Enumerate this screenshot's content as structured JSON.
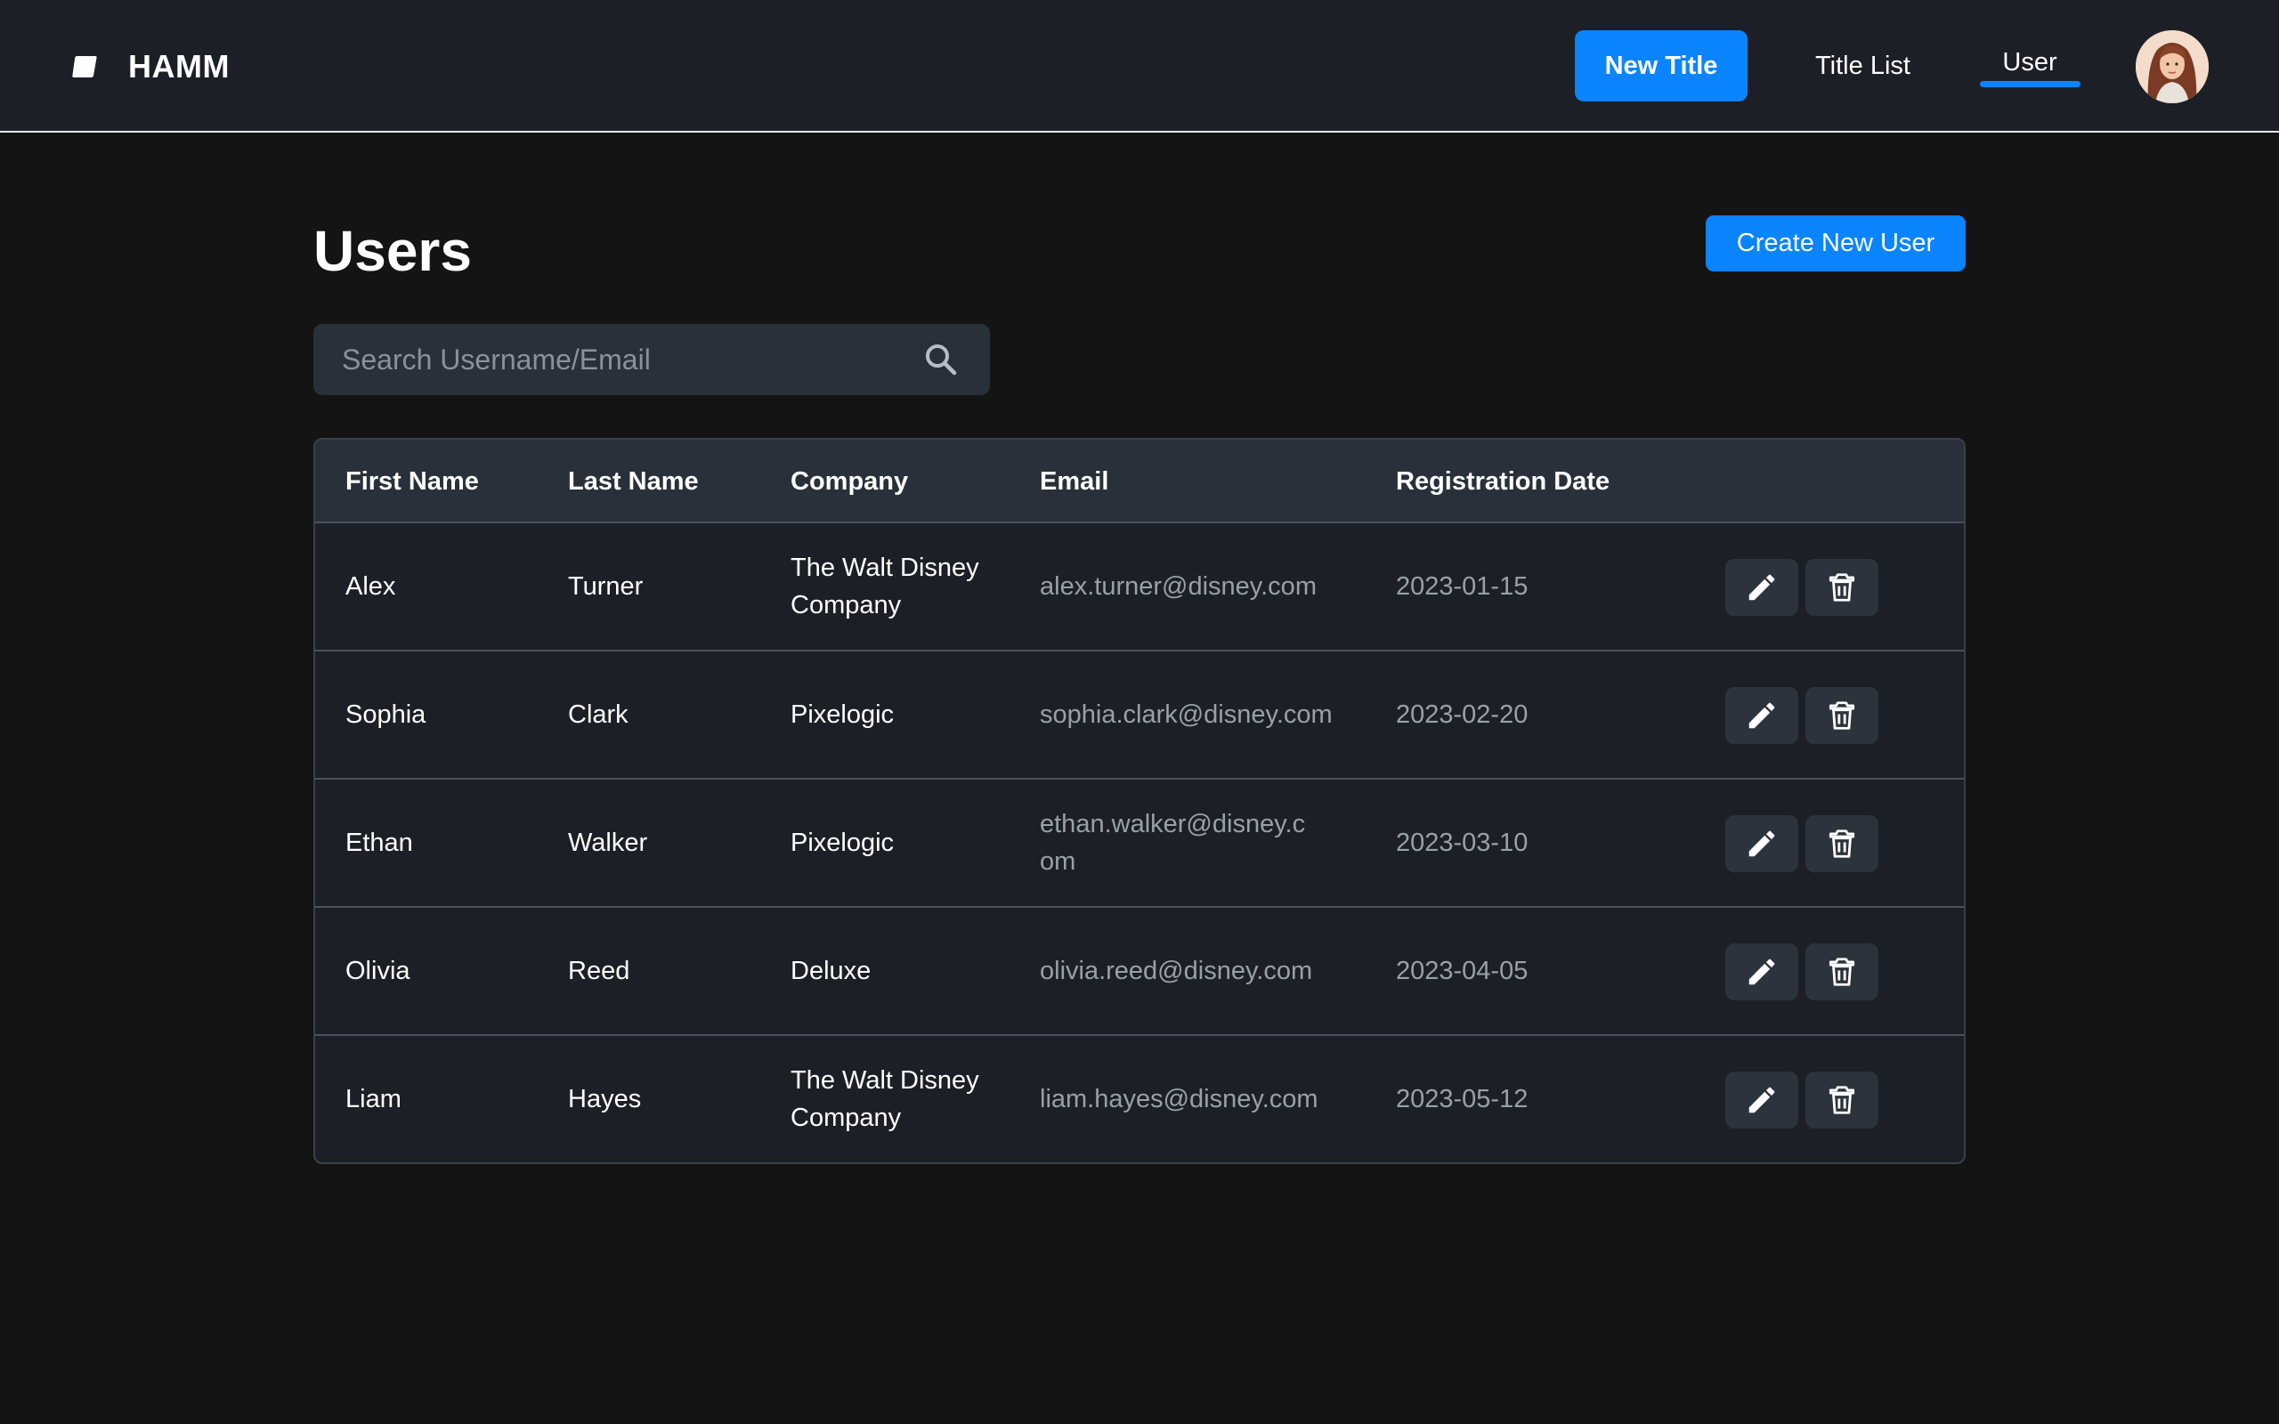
{
  "header": {
    "brand": "HAMM",
    "nav": {
      "new_title": "New Title",
      "title_list": "Title List",
      "user": "User"
    }
  },
  "main": {
    "title": "Users",
    "create_button": "Create New User",
    "search": {
      "placeholder": "Search Username/Email",
      "value": ""
    },
    "table": {
      "columns": [
        "First Name",
        "Last Name",
        "Company",
        "Email",
        "Registration Date"
      ],
      "rows": [
        {
          "first": "Alex",
          "last": "Turner",
          "company": "The Walt Disney Company",
          "email": "alex.turner@disney.com",
          "date": "2023-01-15"
        },
        {
          "first": "Sophia",
          "last": "Clark",
          "company": "Pixelogic",
          "email": "sophia.clark@disney.com",
          "date": "2023-02-20"
        },
        {
          "first": "Ethan",
          "last": "Walker",
          "company": "Pixelogic",
          "email": "ethan.walker@disney.com",
          "date": "2023-03-10"
        },
        {
          "first": "Olivia",
          "last": "Reed",
          "company": "Deluxe",
          "email": "olivia.reed@disney.com",
          "date": "2023-04-05"
        },
        {
          "first": "Liam",
          "last": "Hayes",
          "company": "The Walt Disney Company",
          "email": "liam.hayes@disney.com",
          "date": "2023-05-12"
        }
      ],
      "row_actions": [
        "pencil-icon",
        "trash-icon"
      ]
    }
  },
  "colors": {
    "accent": "#0a84ff",
    "background": "#141414",
    "surface": "#1c2026",
    "muted_text": "#9aa0a8"
  }
}
